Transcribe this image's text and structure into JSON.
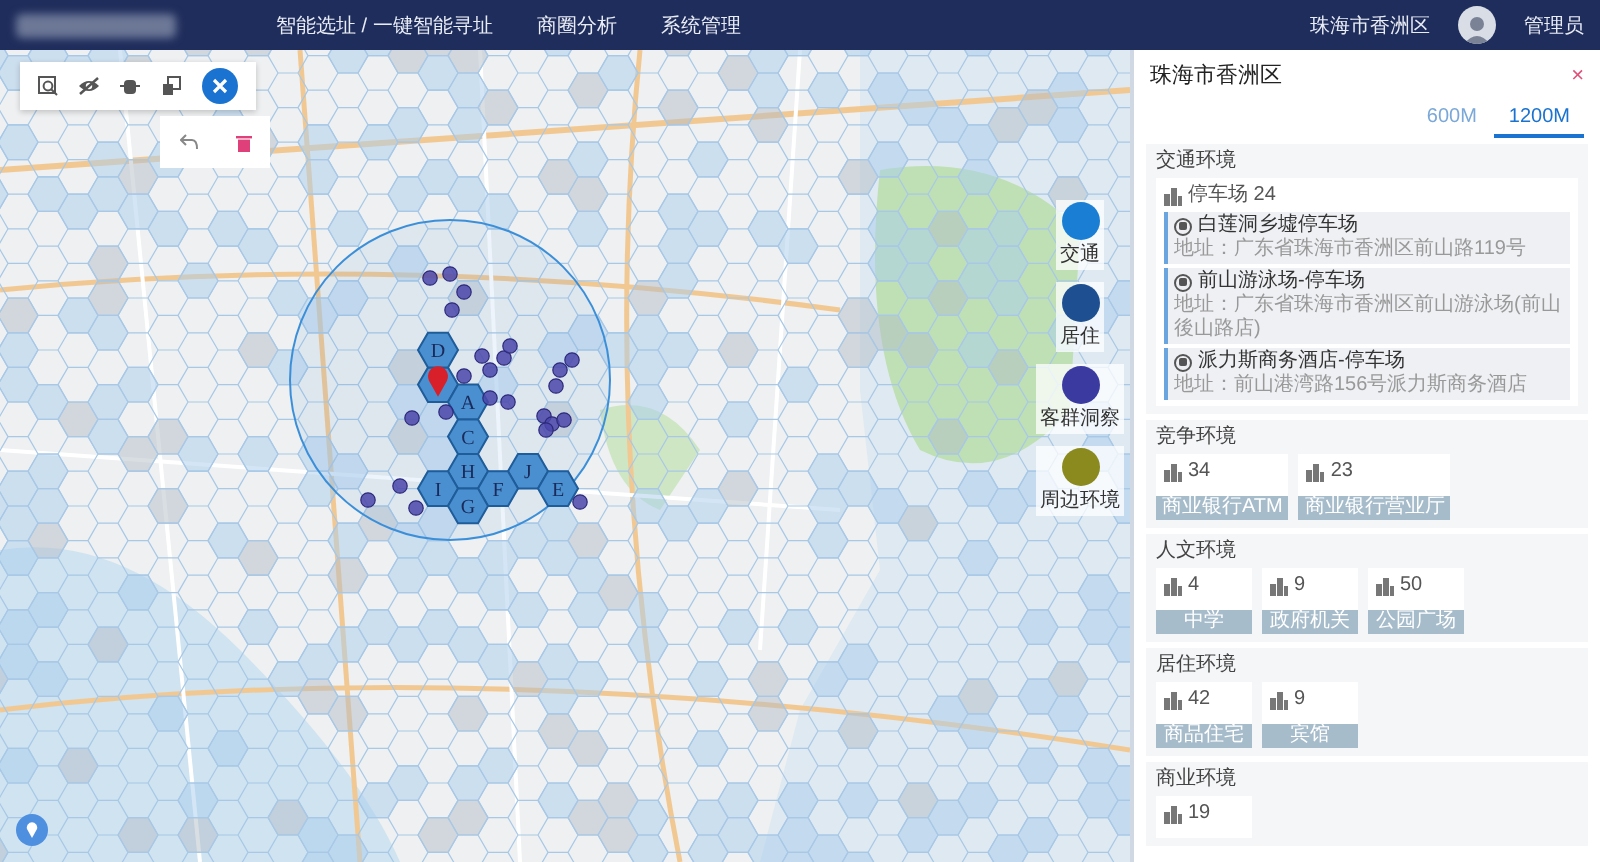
{
  "top_bar": {
    "nav": [
      {
        "label": "智能选址 / 一键智能寻址"
      },
      {
        "label": "商圈分析"
      },
      {
        "label": "系统管理"
      }
    ],
    "region": "珠海市香洲区",
    "user": "管理员"
  },
  "map": {
    "grid_cells": [
      {
        "label": "D"
      },
      {
        "label": "A"
      },
      {
        "label": "C"
      },
      {
        "label": "H"
      },
      {
        "label": "J"
      },
      {
        "label": "I"
      },
      {
        "label": "F"
      },
      {
        "label": "E"
      },
      {
        "label": "G"
      }
    ],
    "floating_buttons": [
      {
        "label": "交通",
        "color": "#1a7fd4"
      },
      {
        "label": "居住",
        "color": "#1d4f91"
      },
      {
        "label": "客群洞察",
        "color": "#3a3aa0"
      },
      {
        "label": "周边环境",
        "color": "#8a8a1e"
      }
    ]
  },
  "panel": {
    "title": "珠海市香洲区",
    "close": "×",
    "tabs": [
      {
        "label": "600M",
        "selected": false
      },
      {
        "label": "1200M",
        "selected": true
      }
    ],
    "sections": [
      {
        "kind": "list",
        "title": "交通环境",
        "count_label": "停车场 24",
        "items": [
          {
            "name": "白莲洞乡墟停车场",
            "address": "地址：广东省珠海市香洲区前山路119号"
          },
          {
            "name": "前山游泳场-停车场",
            "address": "地址：广东省珠海市香洲区前山游泳场(前山後山路店)"
          },
          {
            "name": "派力斯商务酒店-停车场",
            "address": "地址：前山港湾路156号派力斯商务酒店"
          }
        ]
      },
      {
        "kind": "cards",
        "title": "竞争环境",
        "cards": [
          {
            "count": "34",
            "label": "商业银行ATM"
          },
          {
            "count": "23",
            "label": "商业银行营业厅"
          }
        ]
      },
      {
        "kind": "cards",
        "title": "人文环境",
        "cards": [
          {
            "count": "4",
            "label": "中学"
          },
          {
            "count": "9",
            "label": "政府机关"
          },
          {
            "count": "50",
            "label": "公园广场"
          }
        ]
      },
      {
        "kind": "cards",
        "title": "居住环境",
        "cards": [
          {
            "count": "42",
            "label": "商品住宅"
          },
          {
            "count": "9",
            "label": "宾馆"
          }
        ]
      },
      {
        "kind": "cards",
        "title": "商业环境",
        "cards": [
          {
            "count": "19"
          }
        ]
      }
    ]
  }
}
